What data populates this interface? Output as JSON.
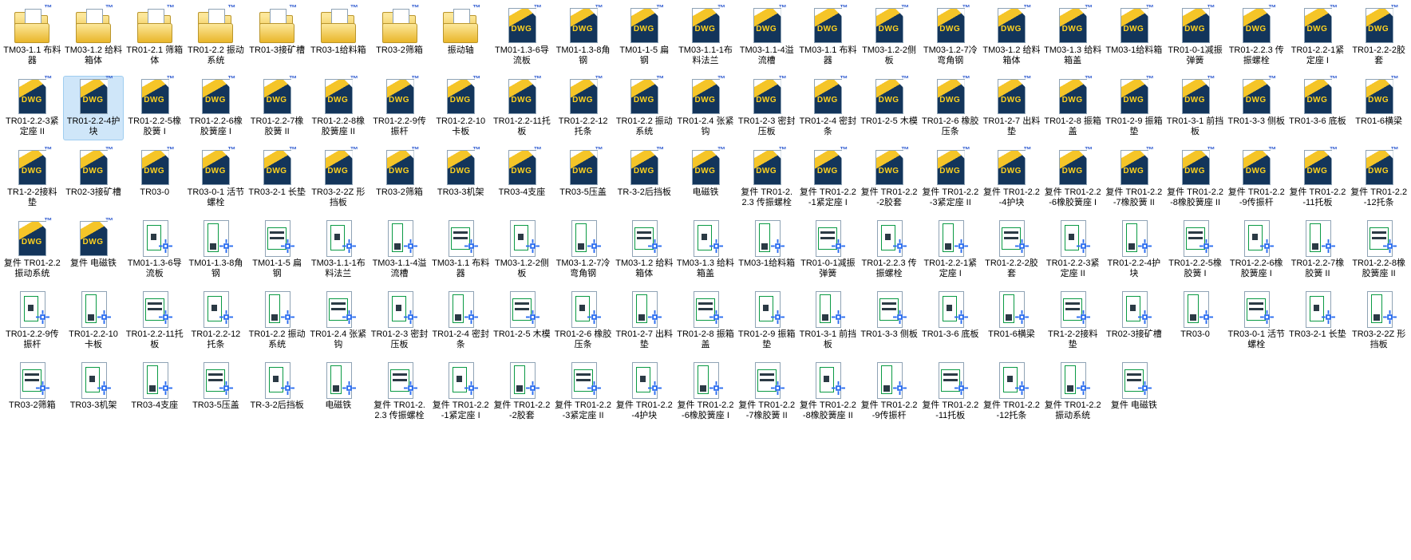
{
  "window": {
    "description": "File explorer icon view of CAD drawing files",
    "background": "#ffffff"
  },
  "colors": {
    "background": "#ffffff",
    "selection-fill": "#cfe6f9",
    "selection-border": "#9fcdf0",
    "label-color": "#000000",
    "folder-light": "#fce79a",
    "folder-dark": "#e9b62a",
    "folder-border": "#b9952c",
    "dwg-navy": "#13355b",
    "dwg-gold": "#f5c528",
    "dwg-text": "#ffd21e",
    "tm-blue": "#2f5bd0",
    "sheet-border": "#8fa3b5",
    "preview-green": "#0a9a44",
    "preview-dark": "#2b3a45",
    "cursor-blue": "#2a6cf0"
  },
  "icons": {
    "folder": "dwg-folder-icon",
    "dwg_file": "dwg-file-icon",
    "dwg_preview": "dwg-preview-icon",
    "cad_cursor": "cad-cursor-icon",
    "dwg_label": "DWG",
    "trademark_glyph": "™"
  },
  "file_grid": {
    "columns": 23,
    "item_count": 134,
    "selected_item": "TR01-2.2-4护块"
  },
  "items": [
    {
      "label": "TM03-1.1 布料器",
      "type": "folder"
    },
    {
      "label": "TM03-1.2 给料箱体",
      "type": "folder"
    },
    {
      "label": "TR01-2.1 筛箱体",
      "type": "folder"
    },
    {
      "label": "TR01-2.2 振动系统",
      "type": "folder"
    },
    {
      "label": "TR01-3接矿槽",
      "type": "folder"
    },
    {
      "label": "TR03-1给料箱",
      "type": "folder"
    },
    {
      "label": "TR03-2筛箱",
      "type": "folder"
    },
    {
      "label": "振动轴",
      "type": "folder"
    },
    {
      "label": "TM01-1.3-6导流板",
      "type": "dwg"
    },
    {
      "label": "TM01-1.3-8角钢",
      "type": "dwg"
    },
    {
      "label": "TM01-1-5 扁钢",
      "type": "dwg"
    },
    {
      "label": "TM03-1.1-1布料法兰",
      "type": "dwg"
    },
    {
      "label": "TM03-1.1-4溢流槽",
      "type": "dwg"
    },
    {
      "label": "TM03-1.1 布料器",
      "type": "dwg"
    },
    {
      "label": "TM03-1.2-2侧板",
      "type": "dwg"
    },
    {
      "label": "TM03-1.2-7冷弯角钢",
      "type": "dwg"
    },
    {
      "label": "TM03-1.2 给料箱体",
      "type": "dwg"
    },
    {
      "label": "TM03-1.3 给料箱盖",
      "type": "dwg"
    },
    {
      "label": "TM03-1给料箱",
      "type": "dwg"
    },
    {
      "label": "TR01-0-1减振弹簧",
      "type": "dwg"
    },
    {
      "label": "TR01-2.2.3 传振螺栓",
      "type": "dwg"
    },
    {
      "label": "TR01-2.2-1紧定座 I",
      "type": "dwg"
    },
    {
      "label": "TR01-2.2-2胶套",
      "type": "dwg"
    },
    {
      "label": "TR01-2.2-3紧定座 II",
      "type": "dwg"
    },
    {
      "label": "TR01-2.2-4护块",
      "type": "dwg",
      "selected": true
    },
    {
      "label": "TR01-2.2-5橡胶簧 I",
      "type": "dwg"
    },
    {
      "label": "TR01-2.2-6橡胶簧座 I",
      "type": "dwg"
    },
    {
      "label": "TR01-2.2-7橡胶簧 II",
      "type": "dwg"
    },
    {
      "label": "TR01-2.2-8橡胶簧座 II",
      "type": "dwg"
    },
    {
      "label": "TR01-2.2-9传振杆",
      "type": "dwg"
    },
    {
      "label": "TR01-2.2-10卡板",
      "type": "dwg"
    },
    {
      "label": "TR01-2.2-11托板",
      "type": "dwg"
    },
    {
      "label": "TR01-2.2-12托条",
      "type": "dwg"
    },
    {
      "label": "TR01-2.2 振动系统",
      "type": "dwg"
    },
    {
      "label": "TR01-2.4 张紧钩",
      "type": "dwg"
    },
    {
      "label": "TR01-2-3 密封压板",
      "type": "dwg"
    },
    {
      "label": "TR01-2-4 密封条",
      "type": "dwg"
    },
    {
      "label": "TR01-2-5 木模",
      "type": "dwg"
    },
    {
      "label": "TR01-2-6 橡胶压条",
      "type": "dwg"
    },
    {
      "label": "TR01-2-7 出料垫",
      "type": "dwg"
    },
    {
      "label": "TR01-2-8 振箱盖",
      "type": "dwg"
    },
    {
      "label": "TR01-2-9 振箱垫",
      "type": "dwg"
    },
    {
      "label": "TR01-3-1 前挡板",
      "type": "dwg"
    },
    {
      "label": "TR01-3-3 侧板",
      "type": "dwg"
    },
    {
      "label": "TR01-3-6 底板",
      "type": "dwg"
    },
    {
      "label": "TR01-6横梁",
      "type": "dwg"
    },
    {
      "label": "TR1-2-2接料垫",
      "type": "dwg"
    },
    {
      "label": "TR02-3接矿槽",
      "type": "dwg"
    },
    {
      "label": "TR03-0",
      "type": "dwg"
    },
    {
      "label": "TR03-0-1 活节螺栓",
      "type": "dwg"
    },
    {
      "label": "TR03-2-1 长垫",
      "type": "dwg"
    },
    {
      "label": "TR03-2-2Z 形挡板",
      "type": "dwg"
    },
    {
      "label": "TR03-2筛箱",
      "type": "dwg"
    },
    {
      "label": "TR03-3机架",
      "type": "dwg"
    },
    {
      "label": "TR03-4支座",
      "type": "dwg"
    },
    {
      "label": "TR03-5压盖",
      "type": "dwg"
    },
    {
      "label": "TR-3-2后挡板",
      "type": "dwg"
    },
    {
      "label": "电磁铁",
      "type": "dwg"
    },
    {
      "label": "复件 TR01-2.2.3 传振螺栓",
      "type": "dwg"
    },
    {
      "label": "复件 TR01-2.2-1紧定座 I",
      "type": "dwg"
    },
    {
      "label": "复件 TR01-2.2-2胶套",
      "type": "dwg"
    },
    {
      "label": "复件 TR01-2.2-3紧定座 II",
      "type": "dwg"
    },
    {
      "label": "复件 TR01-2.2-4护块",
      "type": "dwg"
    },
    {
      "label": "复件 TR01-2.2-6橡胶簧座 I",
      "type": "dwg"
    },
    {
      "label": "复件 TR01-2.2-7橡胶簧 II",
      "type": "dwg"
    },
    {
      "label": "复件 TR01-2.2-8橡胶簧座 II",
      "type": "dwg"
    },
    {
      "label": "复件 TR01-2.2-9传振杆",
      "type": "dwg"
    },
    {
      "label": "复件 TR01-2.2-11托板",
      "type": "dwg"
    },
    {
      "label": "复件 TR01-2.2-12托条",
      "type": "dwg"
    },
    {
      "label": "复件 TR01-2.2 振动系统",
      "type": "dwg"
    },
    {
      "label": "复件 电磁铁",
      "type": "dwg"
    },
    {
      "label": "TM01-1.3-6导流板",
      "type": "preview"
    },
    {
      "label": "TM01-1.3-8角钢",
      "type": "preview"
    },
    {
      "label": "TM01-1-5 扁钢",
      "type": "preview"
    },
    {
      "label": "TM03-1.1-1布料法兰",
      "type": "preview"
    },
    {
      "label": "TM03-1.1-4溢流槽",
      "type": "preview"
    },
    {
      "label": "TM03-1.1 布料器",
      "type": "preview"
    },
    {
      "label": "TM03-1.2-2侧板",
      "type": "preview"
    },
    {
      "label": "TM03-1.2-7冷弯角钢",
      "type": "preview"
    },
    {
      "label": "TM03-1.2 给料箱体",
      "type": "preview"
    },
    {
      "label": "TM03-1.3 给料箱盖",
      "type": "preview"
    },
    {
      "label": "TM03-1给料箱",
      "type": "preview"
    },
    {
      "label": "TR01-0-1减振弹簧",
      "type": "preview"
    },
    {
      "label": "TR01-2.2.3 传振螺栓",
      "type": "preview"
    },
    {
      "label": "TR01-2.2-1紧定座 I",
      "type": "preview"
    },
    {
      "label": "TR01-2.2-2胶套",
      "type": "preview"
    },
    {
      "label": "TR01-2.2-3紧定座 II",
      "type": "preview"
    },
    {
      "label": "TR01-2.2-4护块",
      "type": "preview"
    },
    {
      "label": "TR01-2.2-5橡胶簧 I",
      "type": "preview"
    },
    {
      "label": "TR01-2.2-6橡胶簧座 I",
      "type": "preview"
    },
    {
      "label": "TR01-2.2-7橡胶簧 II",
      "type": "preview"
    },
    {
      "label": "TR01-2.2-8橡胶簧座 II",
      "type": "preview"
    },
    {
      "label": "TR01-2.2-9传振杆",
      "type": "preview"
    },
    {
      "label": "TR01-2.2-10卡板",
      "type": "preview"
    },
    {
      "label": "TR01-2.2-11托板",
      "type": "preview"
    },
    {
      "label": "TR01-2.2-12托条",
      "type": "preview"
    },
    {
      "label": "TR01-2.2 振动系统",
      "type": "preview"
    },
    {
      "label": "TR01-2.4 张紧钩",
      "type": "preview"
    },
    {
      "label": "TR01-2-3 密封压板",
      "type": "preview"
    },
    {
      "label": "TR01-2-4 密封条",
      "type": "preview"
    },
    {
      "label": "TR01-2-5 木模",
      "type": "preview"
    },
    {
      "label": "TR01-2-6 橡胶压条",
      "type": "preview"
    },
    {
      "label": "TR01-2-7 出料垫",
      "type": "preview"
    },
    {
      "label": "TR01-2-8 振箱盖",
      "type": "preview"
    },
    {
      "label": "TR01-2-9 振箱垫",
      "type": "preview"
    },
    {
      "label": "TR01-3-1 前挡板",
      "type": "preview"
    },
    {
      "label": "TR01-3-3 侧板",
      "type": "preview"
    },
    {
      "label": "TR01-3-6 底板",
      "type": "preview"
    },
    {
      "label": "TR01-6横梁",
      "type": "preview"
    },
    {
      "label": "TR1-2-2接料垫",
      "type": "preview"
    },
    {
      "label": "TR02-3接矿槽",
      "type": "preview"
    },
    {
      "label": "TR03-0",
      "type": "preview"
    },
    {
      "label": "TR03-0-1 活节螺栓",
      "type": "preview"
    },
    {
      "label": "TR03-2-1 长垫",
      "type": "preview"
    },
    {
      "label": "TR03-2-2Z 形挡板",
      "type": "preview"
    },
    {
      "label": "TR03-2筛箱",
      "type": "preview"
    },
    {
      "label": "TR03-3机架",
      "type": "preview"
    },
    {
      "label": "TR03-4支座",
      "type": "preview"
    },
    {
      "label": "TR03-5压盖",
      "type": "preview"
    },
    {
      "label": "TR-3-2后挡板",
      "type": "preview"
    },
    {
      "label": "电磁铁",
      "type": "preview"
    },
    {
      "label": "复件 TR01-2.2.3 传振螺栓",
      "type": "preview"
    },
    {
      "label": "复件 TR01-2.2-1紧定座 I",
      "type": "preview"
    },
    {
      "label": "复件 TR01-2.2-2胶套",
      "type": "preview"
    },
    {
      "label": "复件 TR01-2.2-3紧定座 II",
      "type": "preview"
    },
    {
      "label": "复件 TR01-2.2-4护块",
      "type": "preview"
    },
    {
      "label": "复件 TR01-2.2-6橡胶簧座 I",
      "type": "preview"
    },
    {
      "label": "复件 TR01-2.2-7橡胶簧 II",
      "type": "preview"
    },
    {
      "label": "复件 TR01-2.2-8橡胶簧座 II",
      "type": "preview"
    },
    {
      "label": "复件 TR01-2.2-9传振杆",
      "type": "preview"
    },
    {
      "label": "复件 TR01-2.2-11托板",
      "type": "preview"
    },
    {
      "label": "复件 TR01-2.2-12托条",
      "type": "preview"
    },
    {
      "label": "复件 TR01-2.2 振动系统",
      "type": "preview"
    },
    {
      "label": "复件 电磁铁",
      "type": "preview"
    }
  ]
}
